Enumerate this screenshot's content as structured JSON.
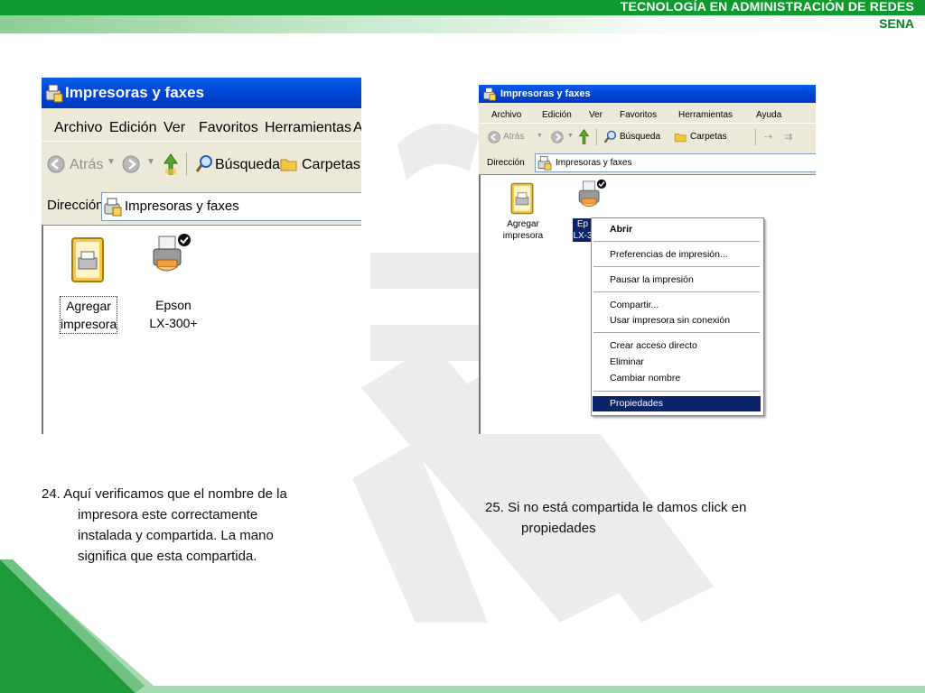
{
  "header": {
    "title": "TECNOLOGÍA EN ADMINISTRACIÓN DE REDES",
    "subtitle": "SENA"
  },
  "window_left": {
    "title": "Impresoras y faxes",
    "menu": [
      "Archivo",
      "Edición",
      "Ver",
      "Favoritos",
      "Herramientas",
      "A"
    ],
    "toolbar": {
      "back": "Atrás",
      "search": "Búsqueda",
      "folders": "Carpetas"
    },
    "address": {
      "label": "Dirección",
      "value": "Impresoras y faxes"
    },
    "icons": [
      {
        "line1": "Agregar",
        "line2": "impresora",
        "icon": "add-printer-icon"
      },
      {
        "line1": "Epson",
        "line2": "LX-300+",
        "icon": "shared-printer-icon"
      }
    ]
  },
  "window_right": {
    "title": "Impresoras y faxes",
    "menu": [
      "Archivo",
      "Edición",
      "Ver",
      "Favoritos",
      "Herramientas",
      "Ayuda"
    ],
    "toolbar": {
      "back": "Atrás",
      "search": "Búsqueda",
      "folders": "Carpetas"
    },
    "address": {
      "label": "Dirección",
      "value": "Impresoras y faxes"
    },
    "icons": [
      {
        "line1": "Agregar",
        "line2": "impresora",
        "icon": "add-printer-icon"
      },
      {
        "line1": "Ep",
        "line2": "LX-3",
        "icon": "printer-icon",
        "selected": true
      }
    ]
  },
  "context_menu": {
    "items": [
      "Abrir",
      "Preferencias de impresión...",
      "Pausar la impresión",
      "Compartir...",
      "Usar impresora sin conexión",
      "Crear acceso directo",
      "Eliminar",
      "Cambiar nombre",
      "Propiedades"
    ],
    "selected": "Propiedades"
  },
  "captions": {
    "left_first": "24. Aquí verificamos que el nombre de la",
    "left_rest": [
      "impresora este correctamente",
      "instalada y compartida. La mano",
      "significa que esta compartida."
    ],
    "right_first": "25. Si no está compartida le damos click en",
    "right_rest": [
      "propiedades"
    ]
  },
  "colors": {
    "header_green": "#0e9a2c",
    "xp_title_blue": "#0047d6",
    "xp_face": "#ece9d8",
    "menu_highlight": "#0a246a"
  }
}
